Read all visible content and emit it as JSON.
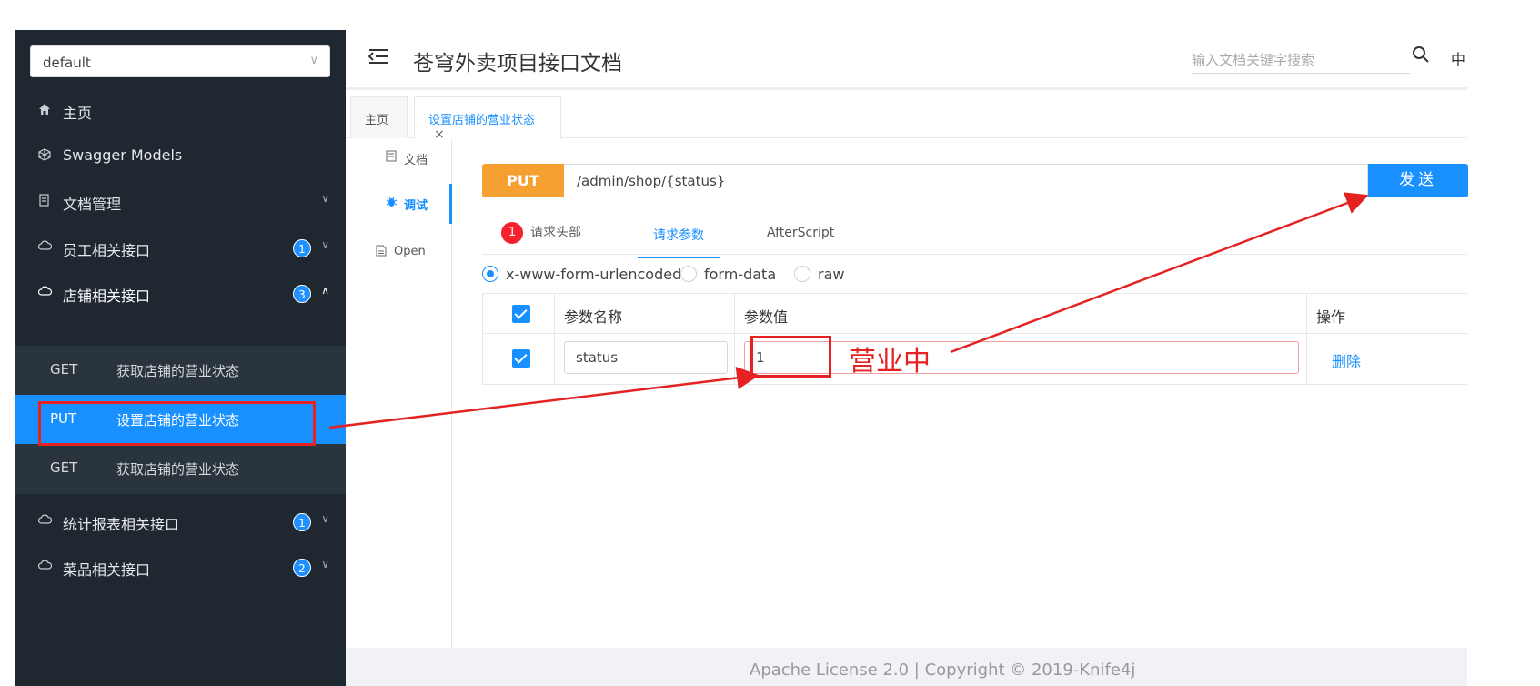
{
  "sidebar": {
    "group_select": "default",
    "items": [
      {
        "label": "主页",
        "icon": "home-icon"
      },
      {
        "label": "Swagger Models",
        "icon": "cube-icon"
      },
      {
        "label": "文档管理",
        "icon": "doc-manage-icon"
      },
      {
        "label": "员工相关接口",
        "icon": "cloud-icon",
        "badge": "1"
      },
      {
        "label": "店铺相关接口",
        "icon": "cloud-icon",
        "badge": "3"
      },
      {
        "label": "统计报表相关接口",
        "icon": "cloud-icon",
        "badge": "1"
      },
      {
        "label": "菜品相关接口",
        "icon": "cloud-icon",
        "badge": "2"
      }
    ],
    "sub_items": [
      {
        "method": "GET",
        "label": "获取店铺的营业状态"
      },
      {
        "method": "PUT",
        "label": "设置店铺的营业状态"
      },
      {
        "method": "GET",
        "label": "获取店铺的营业状态"
      }
    ]
  },
  "header": {
    "title": "苍穹外卖项目接口文档",
    "search_placeholder": "输入文档关键字搜索",
    "lang": "中"
  },
  "tabs": [
    {
      "label": "主页"
    },
    {
      "label": "设置店铺的营业状态",
      "close": "×"
    }
  ],
  "subnav": [
    {
      "label": "文档",
      "icon": "doc-icon"
    },
    {
      "label": "调试",
      "icon": "bug-icon"
    },
    {
      "label": "Open",
      "icon": "open-icon"
    }
  ],
  "request": {
    "method": "PUT",
    "url": "/admin/shop/{status}",
    "send": "发送"
  },
  "param_tabs": {
    "headers_count": "1",
    "headers": "请求头部",
    "params": "请求参数",
    "after": "AfterScript"
  },
  "body_types": [
    "x-www-form-urlencoded",
    "form-data",
    "raw"
  ],
  "param_table": {
    "headers": [
      "参数名称",
      "参数值",
      "操作"
    ],
    "rows": [
      {
        "name": "status",
        "value": "1",
        "action": "删除"
      }
    ]
  },
  "annotation": "营业中",
  "footer": "Apache License 2.0 | Copyright © 2019-Knife4j"
}
